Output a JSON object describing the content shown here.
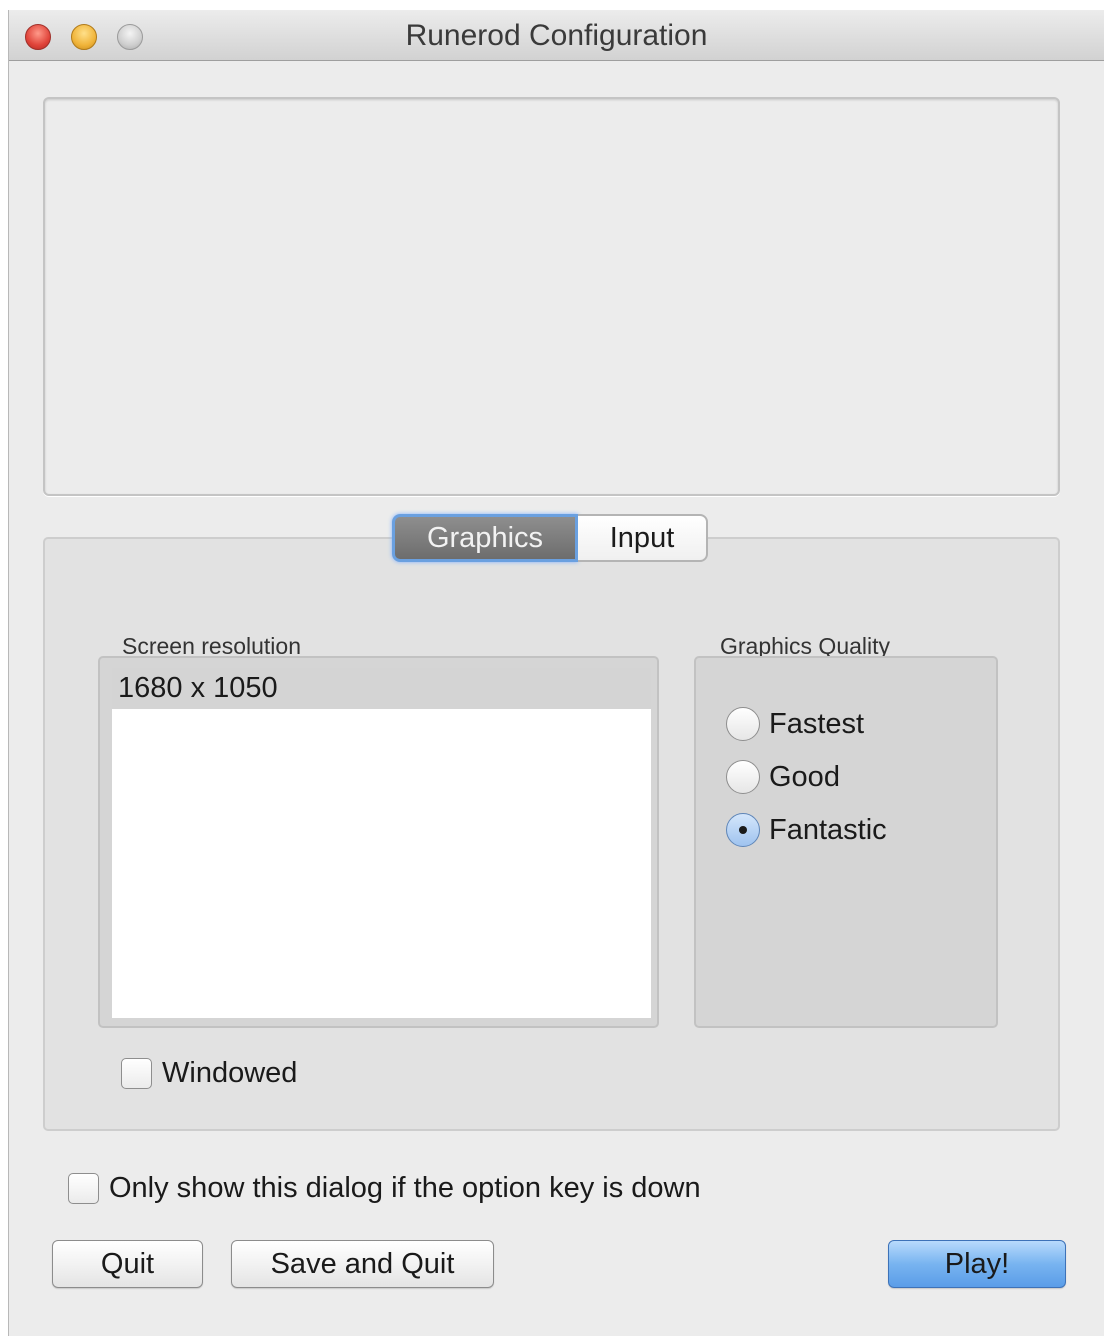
{
  "window": {
    "title": "Runerod Configuration"
  },
  "tabs": [
    {
      "label": "Graphics",
      "active": true
    },
    {
      "label": "Input",
      "active": false
    }
  ],
  "graphics": {
    "resolution_label": "Screen resolution",
    "resolutions": [
      "1680 x 1050"
    ],
    "selected_resolution": "1680 x 1050",
    "quality_label": "Graphics Quality",
    "quality_options": [
      "Fastest",
      "Good",
      "Fantastic"
    ],
    "selected_quality": "Fantastic",
    "windowed_label": "Windowed",
    "windowed_checked": false
  },
  "option_key": {
    "label": "Only show this dialog if the option key is down",
    "checked": false
  },
  "buttons": {
    "quit": "Quit",
    "save_quit": "Save and Quit",
    "play": "Play!"
  },
  "colors": {
    "accent": "#78b4f0",
    "window_bg": "#ececec"
  }
}
